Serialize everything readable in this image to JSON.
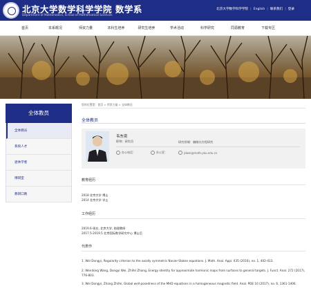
{
  "header": {
    "title": "北京大学数学科学学院 数学系",
    "subtitle": "Department of Mathematics, School of Mathematical Sciences",
    "links": [
      "北京大学数学科学学院",
      "English",
      "联系我们",
      "登录"
    ]
  },
  "nav": {
    "items": [
      "首页",
      "本系概况",
      "师资力量",
      "本科生培养",
      "研究生培养",
      "学术活动",
      "科学研究",
      "同源教育",
      "下载专区"
    ]
  },
  "sidebar": {
    "title": "全体教员",
    "items": [
      "全体教员",
      "系统人才",
      "退休学者",
      "博研室",
      "教研口教"
    ]
  },
  "breadcrumb": {
    "text": "您的位置是：首页 > 师资力量 > 全体教员"
  },
  "main": {
    "section_title": "全体教员",
    "profile": {
      "name": "韦东奕",
      "title": "职称：研究员",
      "field": "研究领域：偏微分方程研究",
      "phone": "办公电话：",
      "office": "办公室：",
      "email": "jdwei@math.pku.edu.cn"
    },
    "education": {
      "heading": "教育经历",
      "lines": [
        "2018 北京大学 博士",
        "2014 北京大学 学士"
      ]
    },
    "work": {
      "heading": "工作经历",
      "lines": [
        "2019.6-现在, 北京大学, 助理教授",
        "2017.5-2019.5 北京国际数学研究中心 博士后"
      ]
    },
    "works": {
      "heading": "代表作",
      "refs": [
        "1. Wei Dongyi, Regularity criterion to the axially symmetric Navier-Stokes equations. J. Math. Anal. Appl. 435 (2016), no. 1, 402-413.",
        "2. Wendong Wang, Dongyi Wei, Zhifei Zhang, Energy identity for approximate harmonic maps from surfaces to general targets. J. Funct. Anal. 272 (2017), 776-803.",
        "3. Wei Dongyi, Zhang Zhifei, Global well-posedness of the MHD equations in a homogeneous magnetic field. Anal. PDE 10 (2017), no. 6, 1361-1406."
      ]
    }
  }
}
